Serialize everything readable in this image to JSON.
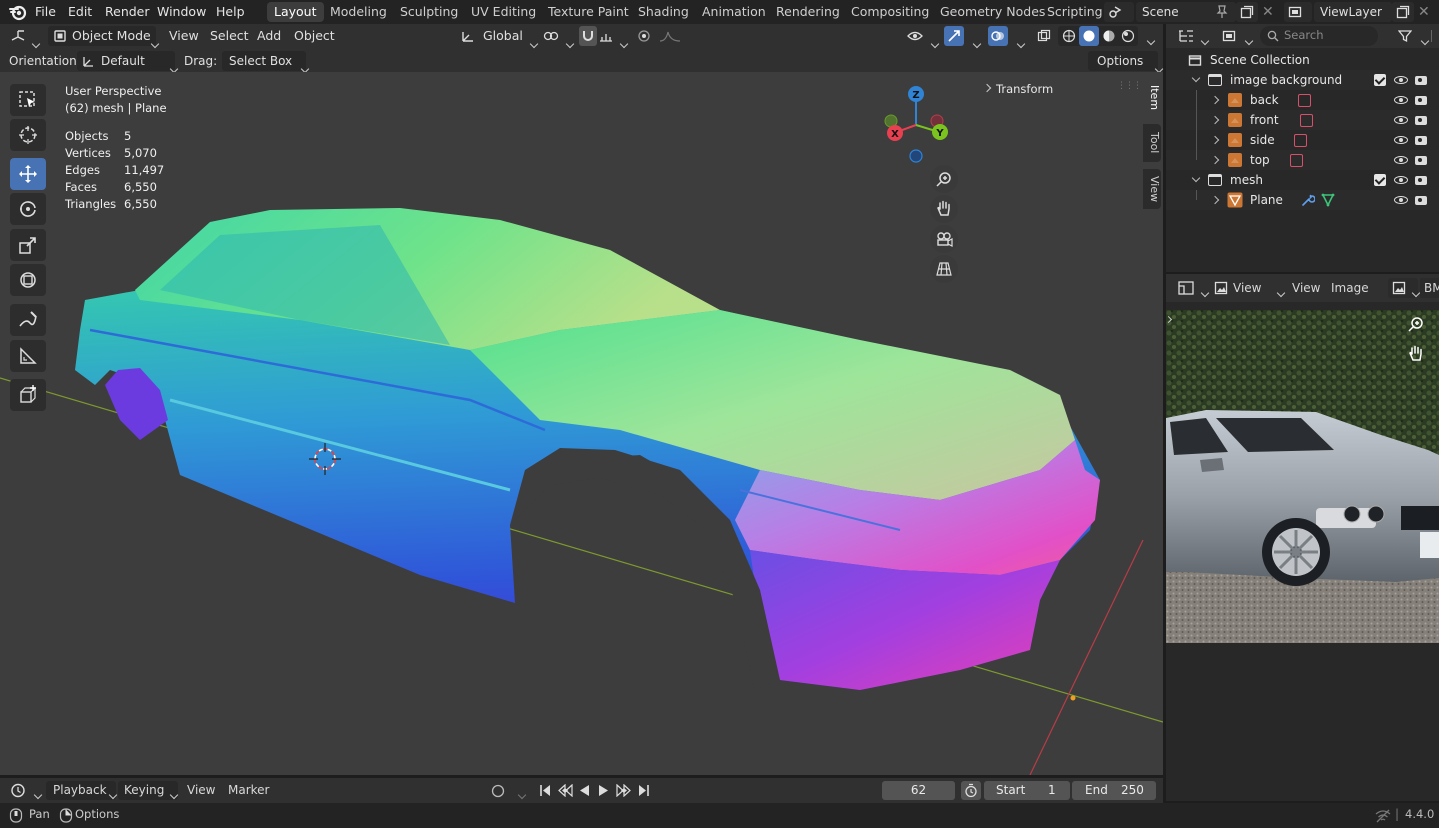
{
  "app": {
    "logo": "blender-logo-icon",
    "version": "4.4.0"
  },
  "menu": {
    "items": [
      "File",
      "Edit",
      "Render",
      "Window",
      "Help"
    ]
  },
  "workspaces": {
    "tabs": [
      "Layout",
      "Modeling",
      "Sculpting",
      "UV Editing",
      "Texture Paint",
      "Shading",
      "Animation",
      "Rendering",
      "Compositing",
      "Geometry Nodes",
      "Scripting"
    ],
    "active": "Layout"
  },
  "scene": {
    "name": "Scene",
    "view_layer": "ViewLayer"
  },
  "viewport_header": {
    "mode": "Object Mode",
    "menus": [
      "View",
      "Select",
      "Add",
      "Object"
    ],
    "transform_orientation": "Global",
    "orientation_label": "Orientation:",
    "orientation_value": "Default",
    "drag_label": "Drag:",
    "drag_value": "Select Box",
    "options": "Options"
  },
  "viewport": {
    "perspective": "User Perspective",
    "object_info": "(62) mesh | Plane",
    "stats": [
      {
        "label": "Objects",
        "value": "5"
      },
      {
        "label": "Vertices",
        "value": "5,070"
      },
      {
        "label": "Edges",
        "value": "11,497"
      },
      {
        "label": "Faces",
        "value": "6,550"
      },
      {
        "label": "Triangles",
        "value": "6,550"
      }
    ],
    "transform_panel": "Transform",
    "side_tabs": [
      "Item",
      "Tool",
      "View"
    ],
    "gizmo_axes": [
      "Z",
      "X",
      "Y"
    ]
  },
  "outliner": {
    "search_placeholder": "Search",
    "root": "Scene Collection",
    "rows": [
      {
        "label": "image background",
        "kind": "collection"
      },
      {
        "label": "back",
        "kind": "image"
      },
      {
        "label": "front",
        "kind": "image"
      },
      {
        "label": "side",
        "kind": "image"
      },
      {
        "label": "top",
        "kind": "image"
      },
      {
        "label": "mesh",
        "kind": "collection"
      },
      {
        "label": "Plane",
        "kind": "mesh"
      }
    ]
  },
  "image_editor": {
    "view_dropdown": "View",
    "menus": [
      "View",
      "Image"
    ],
    "image_name": "BM"
  },
  "timeline": {
    "playback": "Playback",
    "keying": "Keying",
    "view": "View",
    "marker": "Marker",
    "current_frame": "62",
    "start_label": "Start",
    "start": "1",
    "end_label": "End",
    "end": "250"
  },
  "status_bar": {
    "left_action": "Pan",
    "options": "Options",
    "version": "4.4.0"
  },
  "colors": {
    "accent": "#4772b3",
    "axis_x": "#e84050",
    "axis_y": "#7bc41f",
    "axis_z": "#2f84d6"
  }
}
